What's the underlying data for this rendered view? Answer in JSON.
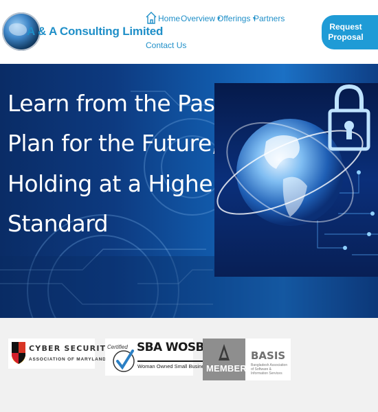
{
  "header": {
    "brand": "A & A Consulting Limited",
    "nav": {
      "home": "Home",
      "overview": "Overview",
      "offerings": "Offerings",
      "partners": "Partners",
      "contact": "Contact Us"
    },
    "cta_line1": "Request",
    "cta_line2": "Proposal"
  },
  "hero": {
    "lines": [
      "Learn from the Past,",
      "Plan for the Future,",
      "Holding at a Higher",
      "Standard"
    ]
  },
  "partners": {
    "csam": {
      "title": "CYBER SECURITY",
      "subtitle": "ASSOCIATION OF MARYLAND, INC."
    },
    "sba": {
      "certified": "Certified",
      "title": "SBA WOSB",
      "subtitle": "Woman Owned Small Business"
    },
    "basis": {
      "member": "MEMBER",
      "title": "BASIS",
      "subtitle": "Bangladesh Association of Software & Information Services"
    }
  },
  "colors": {
    "brand_blue": "#1f8fc8",
    "cta_blue": "#1f9bd6",
    "hero_dark": "#0a2c66",
    "strip_gray": "#f1f1f1"
  },
  "icons": [
    "logo-globe-icon",
    "home-icon",
    "chevron-down-icon",
    "globe-lock-image",
    "maryland-flag-icon",
    "checkmark-icon",
    "basis-triangle-icon"
  ]
}
